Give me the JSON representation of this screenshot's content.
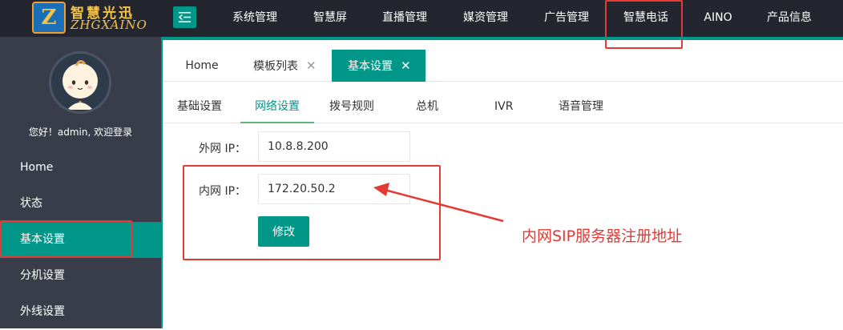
{
  "logo": {
    "mark": "Z",
    "name_cn": "智慧光迅",
    "name_en": "ZHGXAINO"
  },
  "topnav": [
    "系统管理",
    "智慧屏",
    "直播管理",
    "媒资管理",
    "广告管理",
    "智慧电话",
    "AINO",
    "产品信息"
  ],
  "sidebar": {
    "greeting": "您好！admin, 欢迎登录",
    "items": [
      "Home",
      "状态",
      "基本设置",
      "分机设置",
      "外线设置"
    ]
  },
  "tabs": [
    {
      "label": "Home",
      "closable": false
    },
    {
      "label": "模板列表",
      "closable": true
    },
    {
      "label": "基本设置",
      "closable": true
    }
  ],
  "subtabs": [
    "基础设置",
    "网络设置",
    "拨号规则",
    "总机",
    "IVR",
    "语音管理"
  ],
  "form": {
    "external_ip_label": "外网 IP：",
    "external_ip_value": "10.8.8.200",
    "internal_ip_label": "内网 IP：",
    "internal_ip_value": "172.20.50.2",
    "submit_label": "修改"
  },
  "annotation": {
    "text": "内网SIP服务器注册地址",
    "color": "#e53935"
  },
  "colors": {
    "accent": "#009688",
    "topbar": "#23262e",
    "sidebar": "#393d49",
    "highlight": "#e53935"
  }
}
